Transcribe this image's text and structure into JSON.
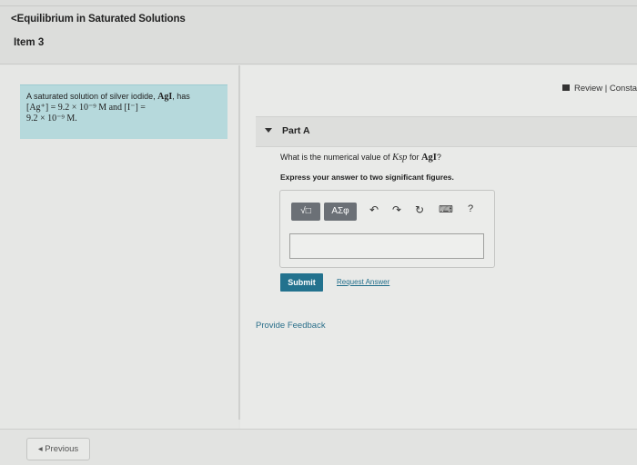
{
  "header": {
    "back_chevron": "<",
    "back_label": "Equilibrium in Saturated Solutions",
    "item_title": "Item 3"
  },
  "problem": {
    "line1_prefix": "A saturated solution of silver iodide,",
    "line1_formula": "AgI",
    "line1_suffix": ", has",
    "line2": "[Ag⁺] = 9.2 × 10⁻⁹ M and [I⁻] =",
    "line3": "9.2 × 10⁻⁹ M."
  },
  "review": {
    "icon": "book-icon",
    "label": "Review | Consta"
  },
  "part": {
    "title": "Part A",
    "question_prefix": "What is the numerical value of",
    "question_var": "Ksp",
    "question_mid": "for",
    "question_formula": "AgI",
    "question_suffix": "?",
    "instruction": "Express your answer to two significant figures."
  },
  "toolbar": {
    "templates_label": "√□",
    "symbols_label": "ΑΣφ",
    "undo_icon": "↶",
    "redo_icon": "↷",
    "reset_icon": "↻",
    "keyboard_icon": "⌨",
    "help_icon": "?"
  },
  "answer": {
    "value": ""
  },
  "actions": {
    "submit": "Submit",
    "request_answer": "Request Answer",
    "feedback": "Provide Feedback"
  },
  "footer": {
    "previous": "◂ Previous"
  },
  "colors": {
    "accent": "#23728e",
    "problem_bg": "#b6d9dc",
    "link": "#1f6d8a"
  }
}
